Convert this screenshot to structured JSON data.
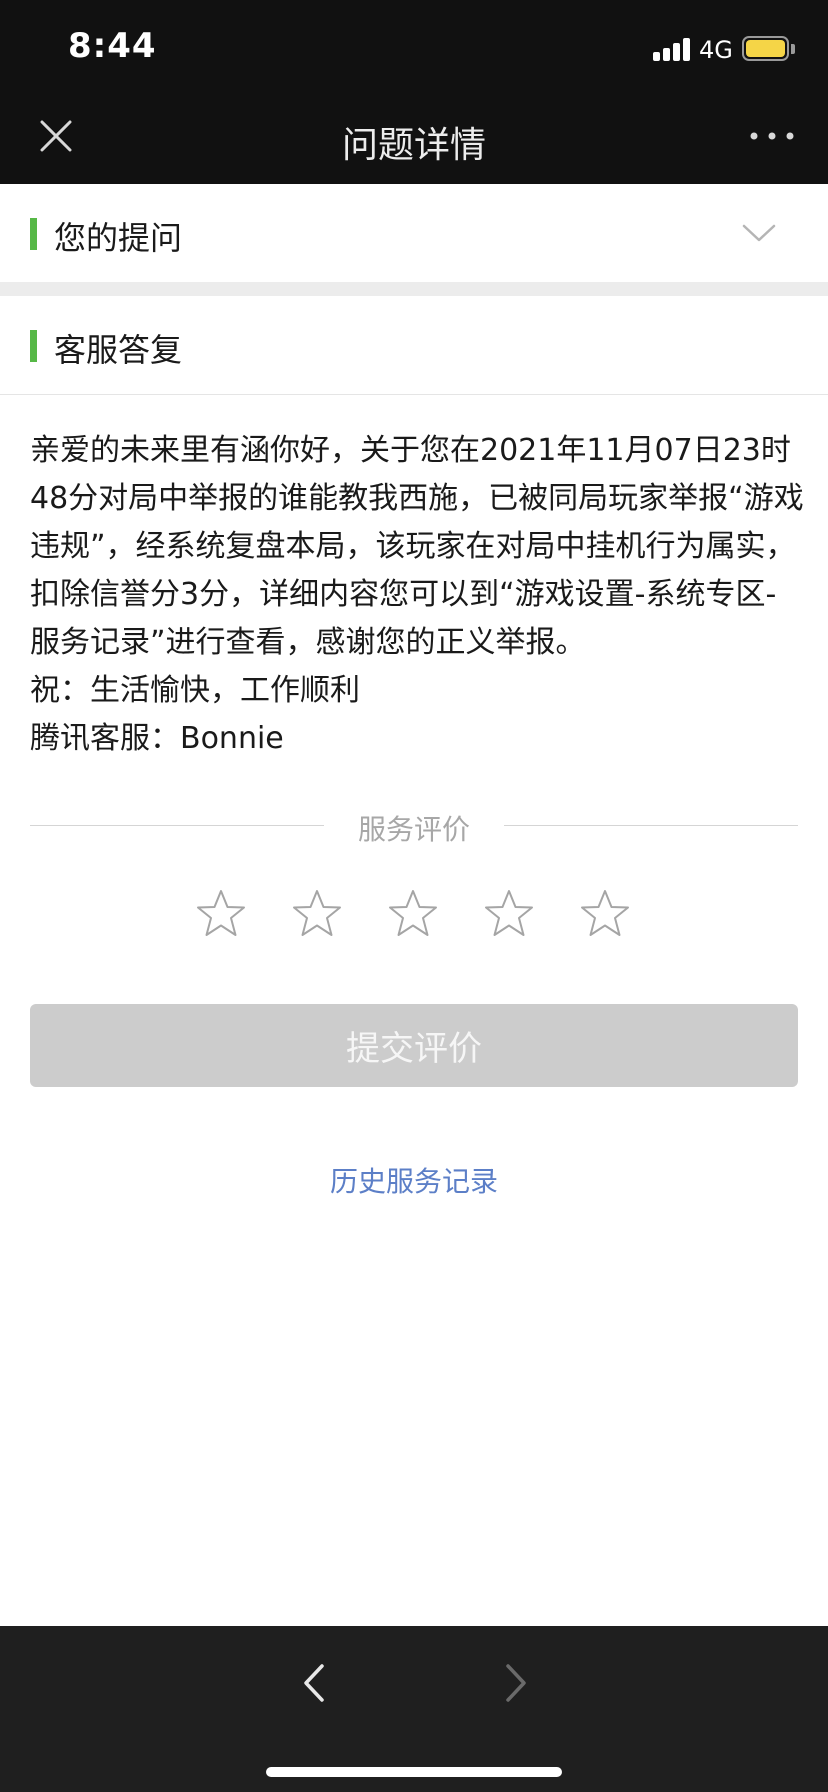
{
  "status_bar": {
    "time": "8:44",
    "network": "4G",
    "signal_icon": "signal-bars-icon",
    "battery_icon": "battery-icon",
    "battery_color": "#f5d547"
  },
  "nav": {
    "title": "问题详情",
    "close_icon": "close-icon",
    "more_icon": "more-dots-icon"
  },
  "question_section": {
    "label": "您的提问",
    "expand_icon": "chevron-down-icon"
  },
  "answer_section": {
    "label": "客服答复",
    "paragraphs": [
      "亲爱的未来里有涵你好，关于您在2021年11月07日23时48分对局中举报的谁能教我西施，已被同局玩家举报“游戏违规”，经系统复盘本局，该玩家在对局中挂机行为属实，扣除信誉分3分，详细内容您可以到“游戏设置-系统专区-服务记录”进行查看，感谢您的正义举报。",
      "祝：生活愉快，工作顺利",
      "腾讯客服：Bonnie"
    ]
  },
  "rating": {
    "title": "服务评价",
    "max_stars": 5,
    "selected_stars": 0,
    "submit_label": "提交评价"
  },
  "history_link": "历史服务记录",
  "bottom_nav": {
    "back_icon": "back-arrow-icon",
    "forward_icon": "forward-arrow-icon"
  },
  "colors": {
    "accent_green": "#57b847",
    "link_blue": "#5c7fc7",
    "disabled_button": "#cccccc",
    "header_bg": "#111111"
  }
}
